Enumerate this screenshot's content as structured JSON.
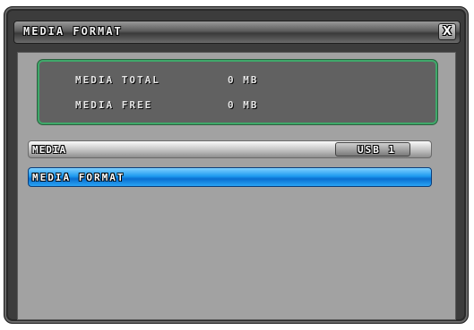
{
  "dialog": {
    "title": "MEDIA FORMAT",
    "close_label": "X"
  },
  "info": {
    "total_label": "MEDIA TOTAL",
    "total_value": "0 MB",
    "free_label": "MEDIA FREE",
    "free_value": "0 MB"
  },
  "media": {
    "label": "MEDIA",
    "selected": "USB 1"
  },
  "format": {
    "label": "MEDIA FORMAT"
  },
  "colors": {
    "accent": "#1e9af0",
    "info_border": "#3fa86a"
  }
}
